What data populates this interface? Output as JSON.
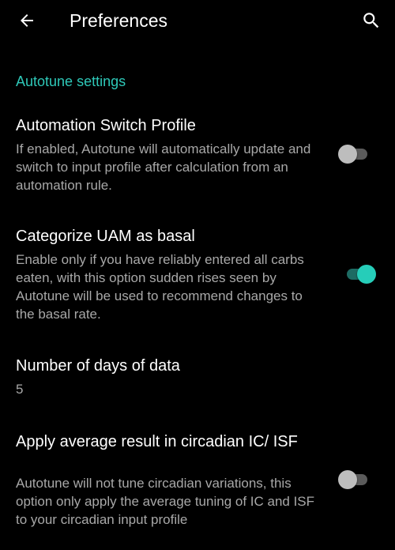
{
  "header": {
    "back_icon": "arrow-left-icon",
    "title": "Preferences",
    "search_icon": "search-icon"
  },
  "section": {
    "title": "Autotune settings"
  },
  "preferences": [
    {
      "title": "Automation Switch Profile",
      "summary": "If enabled, Autotune will automatically update and switch to input profile after calculation from an automation rule.",
      "enabled": false
    },
    {
      "title": "Categorize UAM as basal",
      "summary": "Enable only if you have reliably entered all carbs eaten, with this option sudden rises seen by Autotune will be used to recommend changes to the basal rate.",
      "enabled": true
    },
    {
      "title": "Number of days of data",
      "value": "5"
    },
    {
      "title": "Apply average result in circadian IC/ ISF",
      "summary": "Autotune will not tune circadian variations, this option only apply the average tuning of IC and ISF to your circadian input profile",
      "enabled": false
    }
  ],
  "colors": {
    "background": "#000000",
    "accent": "#2ec8b8",
    "primary_text": "#ffffff",
    "secondary_text": "#a8a8a8",
    "switch_on_thumb": "#26cdb9",
    "switch_off_thumb": "#bdbdbd"
  }
}
